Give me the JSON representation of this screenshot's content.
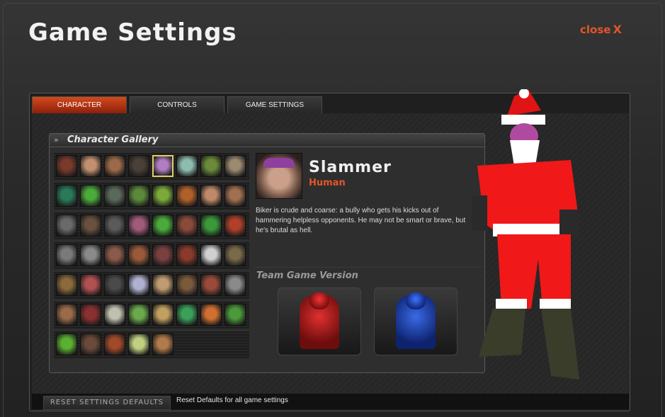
{
  "window": {
    "title": "Game Settings",
    "close_label": "close",
    "close_icon": "X"
  },
  "tabs": [
    {
      "label": "CHARACTER",
      "active": true
    },
    {
      "label": "CONTROLS",
      "active": false
    },
    {
      "label": "GAME SETTINGS",
      "active": false
    }
  ],
  "gallery": {
    "title": "Character Gallery",
    "rows": [
      [
        "#7a3a2a",
        "#c29070",
        "#9a6a4a",
        "#4a4038",
        "#b07ec0",
        "#8fbcb0",
        "#6a8a3a",
        "#9a8a70"
      ],
      [
        "#2a7a5a",
        "#4aaa3a",
        "#5a6a5a",
        "#5a8a3a",
        "#7aaa3a",
        "#b0602a",
        "#c08a6a",
        "#a07050"
      ],
      [
        "#6a6a6a",
        "#6a5040",
        "#5a5a5a",
        "#a05a7a",
        "#4aaa3a",
        "#8a4a3a",
        "#3a9a3a",
        "#b0402a"
      ],
      [
        "#7a7a7a",
        "#8a8a8a",
        "#8a5a4a",
        "#9a5a3a",
        "#7a4040",
        "#8a3a2a",
        "#d0d0d0",
        "#7a6a4a"
      ],
      [
        "#8a6a3a",
        "#b05050",
        "#4a4a4a",
        "#b0b0d0",
        "#c09a70",
        "#7a5a3a",
        "#9a4a3a",
        "#8a8a8a"
      ],
      [
        "#9a6a4a",
        "#8a3030",
        "#c0c0b0",
        "#6aaa4a",
        "#c0a060",
        "#3aa05a",
        "#d07030",
        "#4a9a3a"
      ],
      [
        "#5ab030",
        "#6a4a3a",
        "#a04a2a",
        "#c0d080",
        "#b07a4a"
      ]
    ],
    "selected": {
      "row": 0,
      "col": 4
    }
  },
  "character": {
    "name": "Slammer",
    "race": "Human",
    "description": "Biker is crude and coarse: a bully who gets his kicks out of hammering helpless opponents. He may not be smart or brave, but he's brutal as hell.",
    "team_title": "Team Game Version",
    "team_versions": [
      {
        "team": "red",
        "color": "#d02020"
      },
      {
        "team": "blue",
        "color": "#2a5ad8"
      }
    ]
  },
  "footer": {
    "reset_label": "RESET SETTINGS DEFAULTS",
    "reset_note": "Reset Defaults for all game settings"
  },
  "colors": {
    "accent": "#e2552a",
    "tab_active": "#c0401a",
    "selected_border": "#e0d060"
  }
}
